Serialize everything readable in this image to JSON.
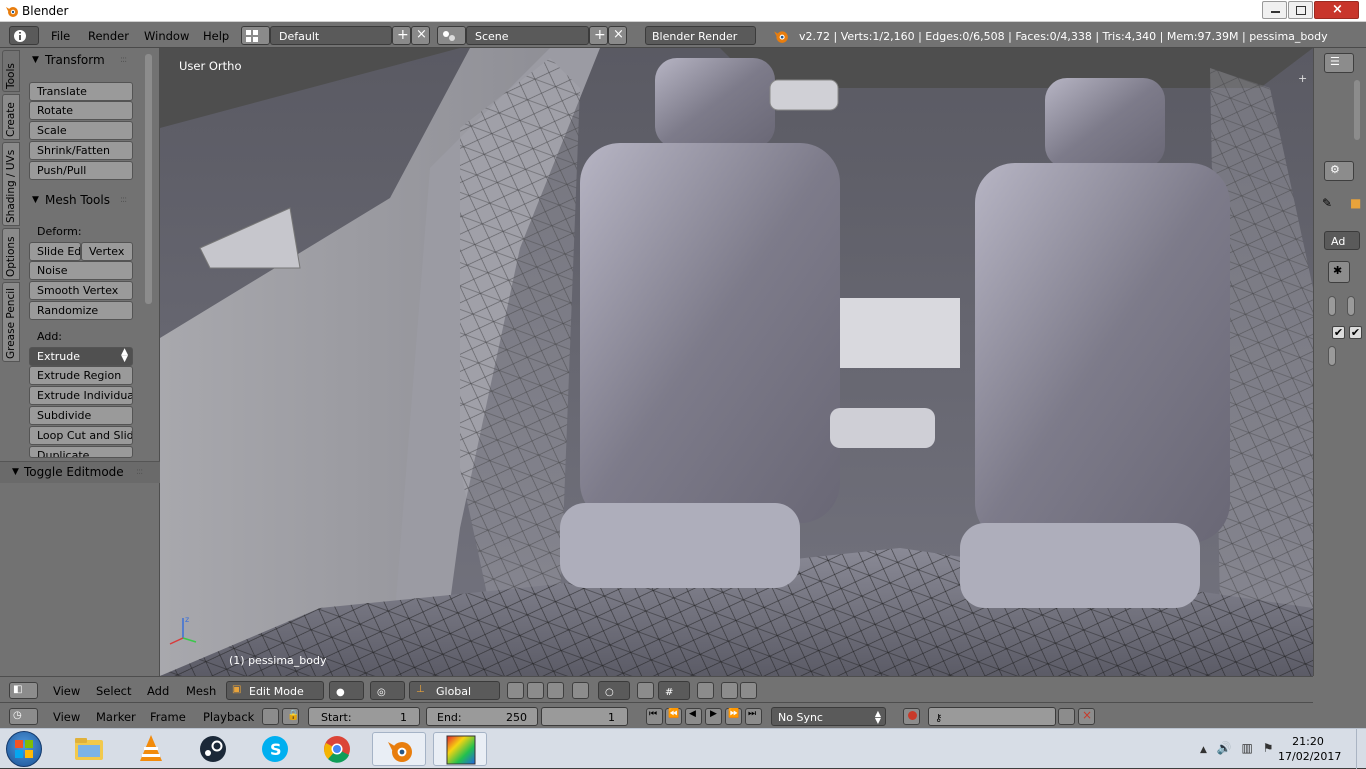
{
  "window": {
    "title": "Blender"
  },
  "info_header": {
    "menus": [
      "File",
      "Render",
      "Window",
      "Help"
    ],
    "layout": "Default",
    "scene": "Scene",
    "engine": "Blender Render",
    "stats": "v2.72 | Verts:1/2,160 | Edges:0/6,508 | Faces:0/4,338 | Tris:4,340 | Mem:97.39M | pessima_body"
  },
  "tool_shelf": {
    "tabs": [
      "Tools",
      "Create",
      "Shading / UVs",
      "Options",
      "Grease Pencil"
    ],
    "transform": {
      "title": "Transform",
      "buttons": [
        "Translate",
        "Rotate",
        "Scale",
        "Shrink/Fatten",
        "Push/Pull"
      ]
    },
    "mesh_tools": {
      "title": "Mesh Tools",
      "deform_label": "Deform:",
      "slide_edge": "Slide Ed",
      "vertex": "Vertex",
      "deform_buttons": [
        "Noise",
        "Smooth Vertex",
        "Randomize"
      ],
      "add_label": "Add:",
      "extrude": "Extrude",
      "add_buttons": [
        "Extrude Region",
        "Extrude Individual",
        "Subdivide",
        "Loop Cut and Slide",
        "Duplicate"
      ]
    },
    "toggle_panel": "Toggle Editmode"
  },
  "viewport": {
    "view_label": "User Ortho",
    "object_label": "(1) pessima_body"
  },
  "right_region": {
    "mode_field": "Ad"
  },
  "view3d_header": {
    "menus": [
      "View",
      "Select",
      "Add",
      "Mesh"
    ],
    "mode": "Edit Mode",
    "orientation": "Global"
  },
  "timeline": {
    "menus": [
      "View",
      "Marker",
      "Frame",
      "Playback"
    ],
    "start_label": "Start:",
    "start": "1",
    "end_label": "End:",
    "end": "250",
    "current": "1",
    "sync": "No Sync"
  },
  "taskbar": {
    "apps": [
      "explorer-icon",
      "vlc-icon",
      "steam-icon",
      "skype-icon",
      "chrome-icon",
      "blender-icon",
      "gallery-icon"
    ],
    "time": "21:20",
    "date": "17/02/2017"
  }
}
